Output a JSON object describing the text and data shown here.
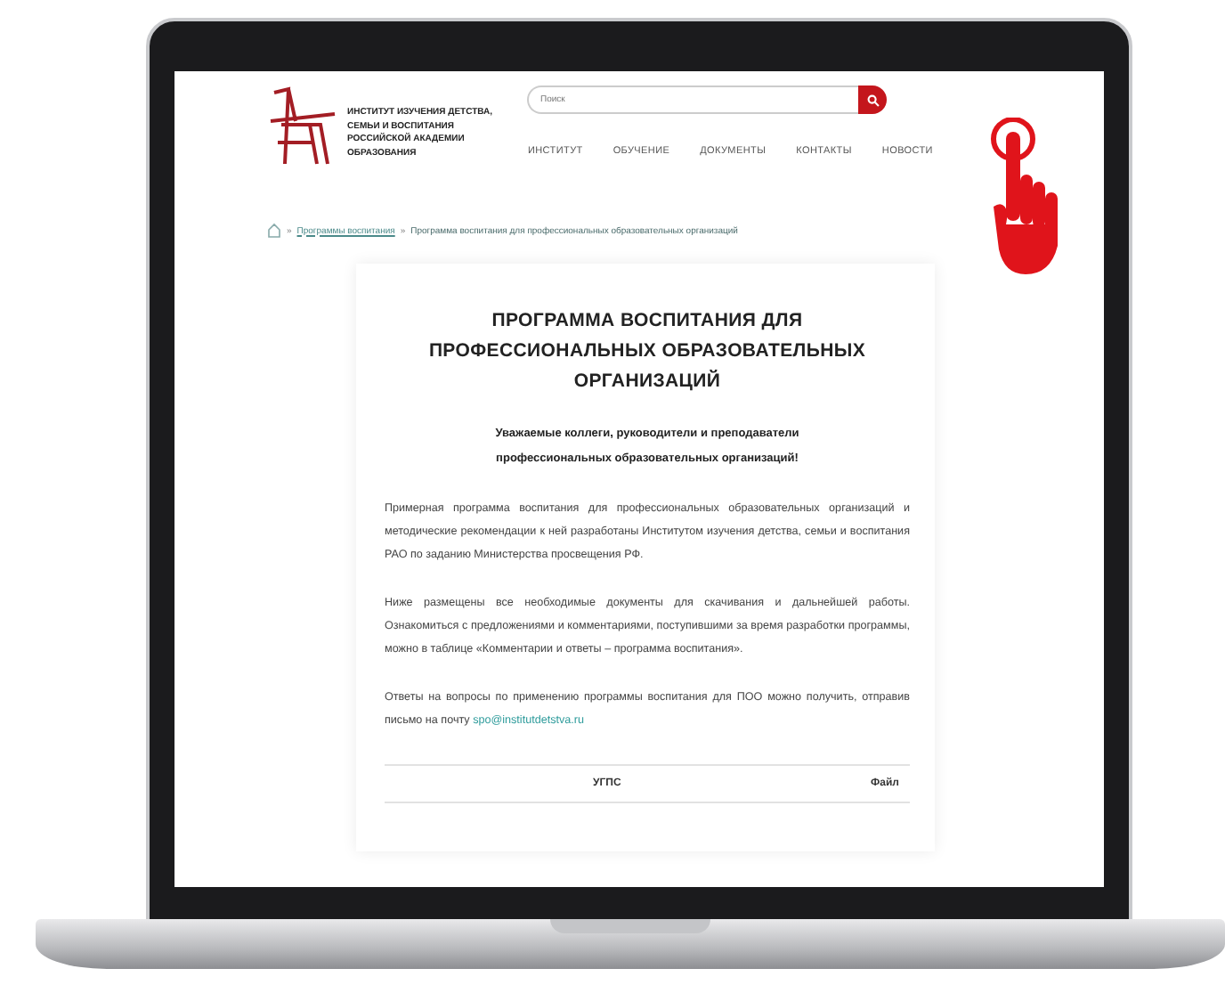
{
  "logo": {
    "lines": [
      "ИНСТИТУТ ИЗУЧЕНИЯ ДЕТСТВА,",
      "СЕМЬИ И ВОСПИТАНИЯ",
      "РОССИЙСКОЙ АКАДЕМИИ",
      "ОБРАЗОВАНИЯ"
    ]
  },
  "search": {
    "placeholder": "Поиск"
  },
  "nav": [
    "ИНСТИТУТ",
    "ОБУЧЕНИЕ",
    "ДОКУМЕНТЫ",
    "КОНТАКТЫ",
    "НОВОСТИ"
  ],
  "breadcrumb": {
    "separator": "»",
    "items": [
      {
        "label": "Программы воспитания",
        "kind": "link"
      },
      {
        "label": "Программа воспитания для профессиональных образовательных организаций",
        "kind": "current"
      }
    ]
  },
  "title": "ПРОГРАММА ВОСПИТАНИЯ ДЛЯ ПРОФЕССИОНАЛЬНЫХ ОБРАЗОВАТЕЛЬНЫХ ОРГАНИЗАЦИЙ",
  "greeting": [
    "Уважаемые коллеги, руководители и преподаватели",
    "профессиональных образовательных организаций!"
  ],
  "paragraphs": [
    {
      "text": "Примерная программа воспитания для профессиональных образовательных организаций и методические рекомендации к ней разработаны Институтом изучения детства, семьи и воспитания РАО по заданию Министерства просвещения РФ."
    },
    {
      "text": "Ниже размещены все необходимые документы для скачивания и дальнейшей работы. Ознакомиться с предложениями и комментариями, поступившими за время разработки программы, можно в таблице «Комментарии и ответы – программа воспитания»."
    },
    {
      "text": "Ответы на вопросы по применению программы воспитания для ПОО можно получить, отправив письмо на почту",
      "link": "spo@institutdetstva.ru"
    }
  ],
  "table": {
    "columns": [
      "УГПС",
      "Файл"
    ]
  }
}
